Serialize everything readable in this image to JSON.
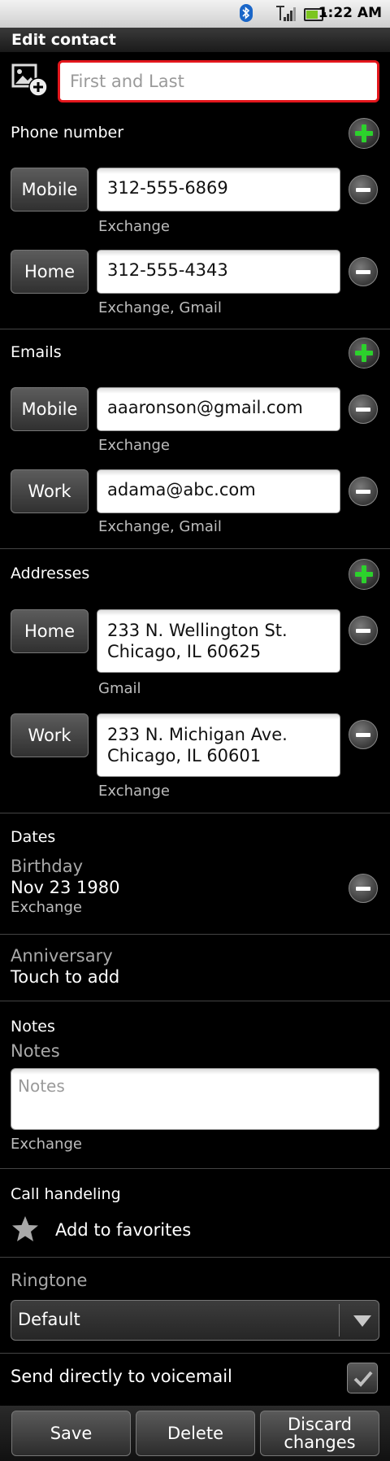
{
  "status_bar": {
    "time": "1:22 AM"
  },
  "title": "Edit contact",
  "name": {
    "placeholder": "First and Last"
  },
  "phones": {
    "label": "Phone number",
    "items": [
      {
        "type": "Mobile",
        "value": "312-555-6869",
        "source": "Exchange"
      },
      {
        "type": "Home",
        "value": "312-555-4343",
        "source": "Exchange, Gmail"
      }
    ]
  },
  "emails": {
    "label": "Emails",
    "items": [
      {
        "type": "Mobile",
        "value": "aaaronson@gmail.com",
        "source": "Exchange"
      },
      {
        "type": "Work",
        "value": "adama@abc.com",
        "source": "Exchange, Gmail"
      }
    ]
  },
  "addresses": {
    "label": "Addresses",
    "items": [
      {
        "type": "Home",
        "line1": "233 N. Wellington St.",
        "line2": "Chicago, IL 60625",
        "source": "Gmail"
      },
      {
        "type": "Work",
        "line1": "233 N. Michigan Ave.",
        "line2": "Chicago, IL 60601",
        "source": "Exchange"
      }
    ]
  },
  "dates": {
    "label": "Dates",
    "birthday": {
      "label": "Birthday",
      "value": "Nov 23 1980",
      "source": "Exchange"
    },
    "anniversary": {
      "label": "Anniversary",
      "value": "Touch to add"
    }
  },
  "notes": {
    "section_label": "Notes",
    "field_label": "Notes",
    "placeholder": "Notes",
    "source": "Exchange"
  },
  "call_handling": {
    "label": "Call handeling",
    "favorites_label": "Add to favorites"
  },
  "ringtone": {
    "label": "Ringtone",
    "value": "Default"
  },
  "voicemail": {
    "label": "Send directly to voicemail",
    "checked": true
  },
  "actions": {
    "save": "Save",
    "delete": "Delete",
    "discard_line1": "Discard",
    "discard_line2": "changes"
  },
  "colors": {
    "accent_green": "#2cd12c",
    "focus_red": "#e3161c"
  }
}
